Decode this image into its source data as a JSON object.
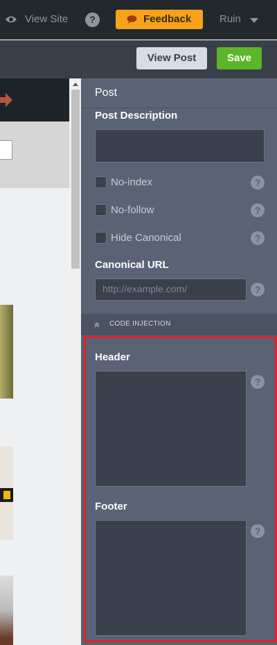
{
  "topbar": {
    "view_site": "View Site",
    "help": "?",
    "feedback": "Feedback",
    "user": "Ruin"
  },
  "actions": {
    "view_post": "View Post",
    "save": "Save"
  },
  "sidebar": {
    "title": "Post",
    "post_description_label": "Post Description",
    "checkboxes": [
      {
        "label": "No-index",
        "checked": false
      },
      {
        "label": "No-follow",
        "checked": false
      },
      {
        "label": "Hide Canonical",
        "checked": false
      }
    ],
    "canonical_label": "Canonical URL",
    "canonical_placeholder": "http://example.com/",
    "code_injection": "CODE INJECTION",
    "header_label": "Header",
    "footer_label": "Footer",
    "help": "?"
  },
  "colors": {
    "feedback": "#f6a21a",
    "save": "#5bb62a",
    "highlight": "#e3202a",
    "sidebar": "#5a6275"
  }
}
